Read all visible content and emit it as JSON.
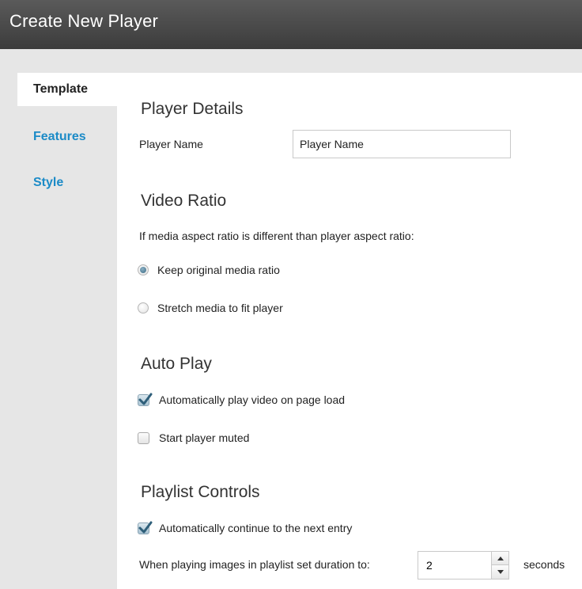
{
  "window": {
    "title": "Create New Player"
  },
  "sidebar": {
    "tabs": [
      {
        "label": "Template",
        "active": true
      },
      {
        "label": "Features",
        "active": false
      },
      {
        "label": "Style",
        "active": false
      }
    ]
  },
  "player_details": {
    "heading": "Player Details",
    "name_label": "Player Name",
    "name_value": "Player Name"
  },
  "video_ratio": {
    "heading": "Video Ratio",
    "description": "If media aspect ratio is different than player aspect ratio:",
    "options": [
      {
        "label": "Keep original media ratio",
        "selected": true
      },
      {
        "label": "Stretch media to fit player",
        "selected": false
      }
    ]
  },
  "auto_play": {
    "heading": "Auto Play",
    "options": [
      {
        "label": "Automatically play video on page load",
        "checked": true
      },
      {
        "label": "Start player muted",
        "checked": false
      }
    ]
  },
  "playlist_controls": {
    "heading": "Playlist Controls",
    "continue_label": "Automatically continue to the next entry",
    "continue_checked": true,
    "duration_label": "When playing images in playlist set duration to:",
    "duration_value": "2",
    "duration_unit": "seconds"
  },
  "colors": {
    "titlebar": "#474747",
    "link": "#1c8bc7",
    "sidebar_bg": "#e6e6e6",
    "content_bg": "#ffffff"
  }
}
